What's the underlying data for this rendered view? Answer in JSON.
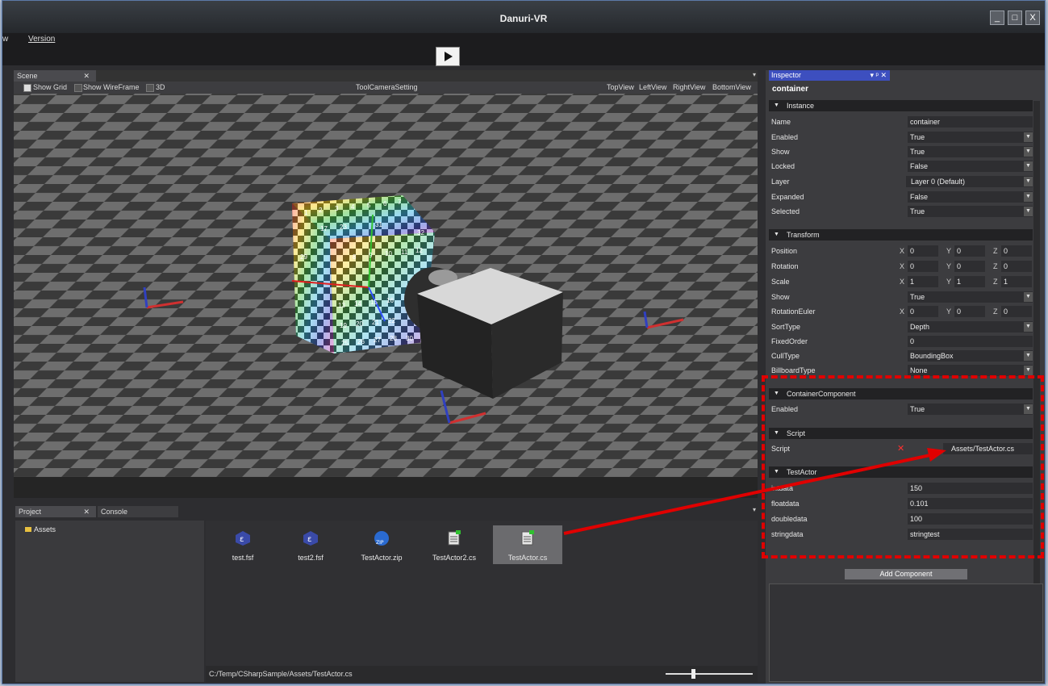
{
  "window": {
    "title": "Danuri-VR",
    "min": "_",
    "max": "□",
    "close": "X"
  },
  "menu": {
    "item_w": "w",
    "item_version": "Version"
  },
  "scene": {
    "tab": "Scene",
    "tab_close": "✕",
    "show_grid": "Show Grid",
    "show_wireframe": "Show WireFrame",
    "three_d": "3D",
    "tool_camera": "ToolCameraSetting",
    "views": [
      "TopView",
      "LeftView",
      "RightView",
      "BottomView"
    ],
    "cube_numbers": [
      "1",
      "2",
      "3",
      "4",
      "5",
      "6",
      "7",
      "8",
      "9",
      "10",
      "11",
      "12",
      "13",
      "14",
      "15",
      "16",
      "17",
      "19",
      "20",
      "21",
      "22",
      "23",
      "25",
      "26",
      "27",
      "28",
      "29",
      "30",
      "31",
      "32"
    ]
  },
  "bottom": {
    "tab_project": "Project",
    "tab_close": "✕",
    "tab_console": "Console",
    "tree_item": "Assets",
    "files": [
      {
        "name": "test.fsf",
        "icon": "fsf-icon"
      },
      {
        "name": "test2.fsf",
        "icon": "fsf-icon"
      },
      {
        "name": "TestActor.zip",
        "icon": "zip-icon"
      },
      {
        "name": "TestActor2.cs",
        "icon": "cs-script-icon"
      },
      {
        "name": "TestActor.cs",
        "icon": "cs-script-icon"
      }
    ],
    "path": "C:/Temp/CSharpSample/Assets/TestActor.cs"
  },
  "inspector": {
    "tab": "Inspector",
    "tab_controls": "▾ ᵖ ✕",
    "object": "container",
    "instance": {
      "header": "Instance",
      "rows": [
        {
          "k": "Name",
          "v": "container"
        },
        {
          "k": "Enabled",
          "v": "True"
        },
        {
          "k": "Show",
          "v": "True"
        },
        {
          "k": "Locked",
          "v": "False"
        },
        {
          "k": "Layer",
          "v": "Layer 0 (Default)"
        },
        {
          "k": "Expanded",
          "v": "False"
        },
        {
          "k": "Selected",
          "v": "True"
        }
      ]
    },
    "transform": {
      "header": "Transform",
      "position": {
        "k": "Position",
        "x": "0",
        "y": "0",
        "z": "0"
      },
      "rotation": {
        "k": "Rotation",
        "x": "0",
        "y": "0",
        "z": "0"
      },
      "scale": {
        "k": "Scale",
        "x": "1",
        "y": "1",
        "z": "1"
      },
      "show": {
        "k": "Show",
        "v": "True"
      },
      "euler": {
        "k": "RotationEuler",
        "x": "0",
        "y": "0",
        "z": "0"
      },
      "sort": {
        "k": "SortType",
        "v": "Depth"
      },
      "fixed": {
        "k": "FixedOrder",
        "v": "0"
      },
      "cull": {
        "k": "CullType",
        "v": "BoundingBox"
      },
      "billboard": {
        "k": "BillboardType",
        "v": "None"
      }
    },
    "container_component": {
      "header": "ContainerComponent",
      "k": "Enabled",
      "v": "True"
    },
    "script": {
      "header": "Script",
      "k": "Script",
      "remove": "✕",
      "v": "Assets/TestActor.cs"
    },
    "test_actor": {
      "header": "TestActor",
      "rows": [
        {
          "k": "intdata",
          "v": "150"
        },
        {
          "k": "floatdata",
          "v": "0.101"
        },
        {
          "k": "doubledata",
          "v": "100"
        },
        {
          "k": "stringdata",
          "v": "stringtest"
        }
      ]
    },
    "add_component": "Add Component"
  },
  "axis_labels": {
    "x": "X",
    "y": "Y",
    "z": "Z"
  },
  "colors": {
    "accent": "#3d4fbf",
    "highlight": "#e00000"
  }
}
